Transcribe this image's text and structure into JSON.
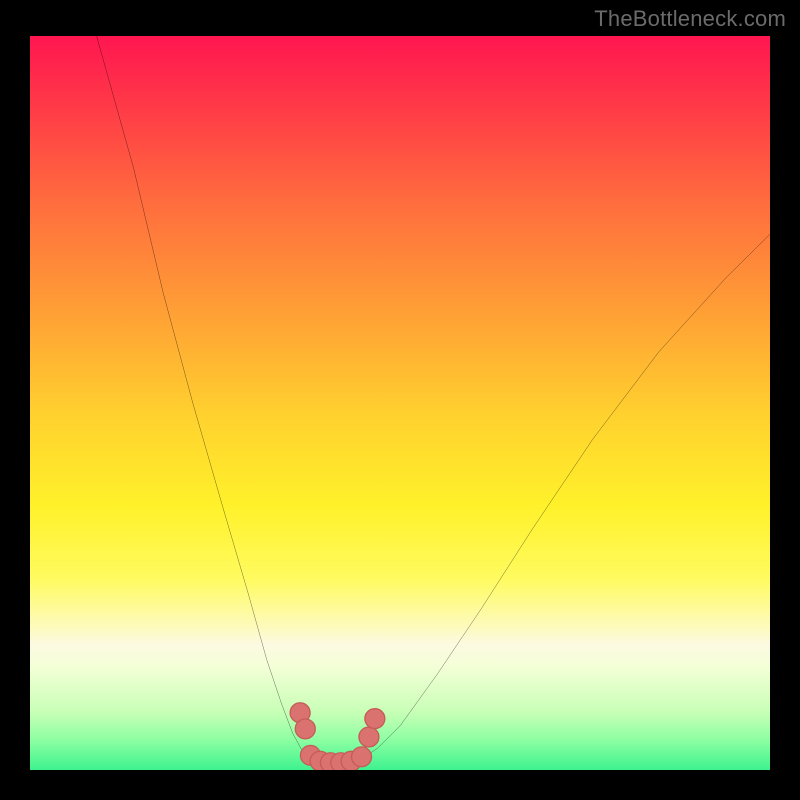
{
  "watermark": "TheBottleneck.com",
  "colors": {
    "frame": "#000000",
    "curve_stroke": "#000000",
    "marker_fill": "#da7270",
    "marker_stroke": "#c65c58"
  },
  "chart_data": {
    "type": "line",
    "title": "",
    "xlabel": "",
    "ylabel": "",
    "xlim": [
      0,
      100
    ],
    "ylim": [
      0,
      100
    ],
    "grid": false,
    "legend_position": "none",
    "series": [
      {
        "name": "curve-left",
        "x": [
          9,
          14,
          18,
          22,
          26,
          29.5,
          32,
          34,
          35.5,
          36.8,
          37.8
        ],
        "y": [
          100,
          82,
          65,
          50,
          36,
          24,
          15,
          9,
          5,
          2.6,
          1.5
        ]
      },
      {
        "name": "curve-bottom",
        "x": [
          37.8,
          39,
          40.5,
          42,
          43.5,
          45
        ],
        "y": [
          1.5,
          1.1,
          1.0,
          1.0,
          1.2,
          1.6
        ]
      },
      {
        "name": "curve-right",
        "x": [
          45,
          47,
          50,
          55,
          61,
          68,
          76,
          85,
          94,
          100
        ],
        "y": [
          1.6,
          3,
          6,
          13,
          22,
          33,
          45,
          57,
          67,
          73
        ]
      }
    ],
    "markers": [
      {
        "x": 36.5,
        "y": 7.8
      },
      {
        "x": 37.2,
        "y": 5.6
      },
      {
        "x": 37.9,
        "y": 2.0
      },
      {
        "x": 39.2,
        "y": 1.2
      },
      {
        "x": 40.6,
        "y": 1.0
      },
      {
        "x": 42.0,
        "y": 1.0
      },
      {
        "x": 43.4,
        "y": 1.2
      },
      {
        "x": 44.8,
        "y": 1.8
      },
      {
        "x": 45.8,
        "y": 4.5
      },
      {
        "x": 46.6,
        "y": 7.0
      }
    ]
  }
}
